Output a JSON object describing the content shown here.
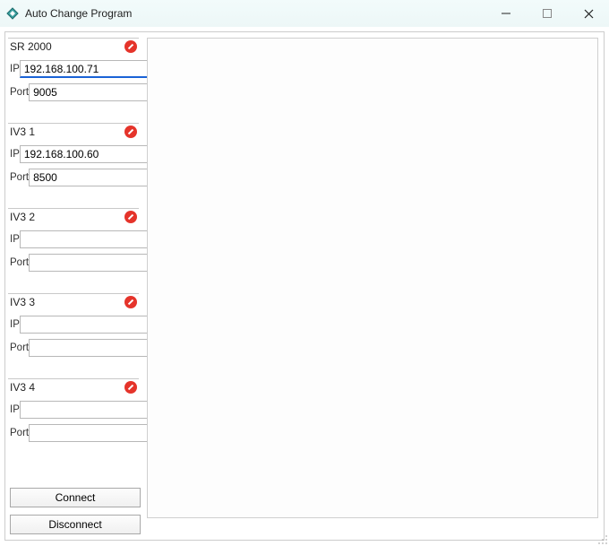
{
  "window": {
    "title": "Auto Change Program"
  },
  "colors": {
    "status_error": "#e5342b",
    "accent": "#1a63d6"
  },
  "groups": [
    {
      "name": "SR 2000",
      "ip_value": "192.168.100.71",
      "port_value": "9005",
      "focused": true
    },
    {
      "name": "IV3 1",
      "ip_value": "192.168.100.60",
      "port_value": "8500",
      "focused": false
    },
    {
      "name": "IV3 2",
      "ip_value": "",
      "port_value": "",
      "focused": false
    },
    {
      "name": "IV3 3",
      "ip_value": "",
      "port_value": "",
      "focused": false
    },
    {
      "name": "IV3 4",
      "ip_value": "",
      "port_value": "",
      "focused": false
    }
  ],
  "labels": {
    "ip": "IP",
    "port": "Port"
  },
  "buttons": {
    "connect": "Connect",
    "disconnect": "Disconnect"
  }
}
